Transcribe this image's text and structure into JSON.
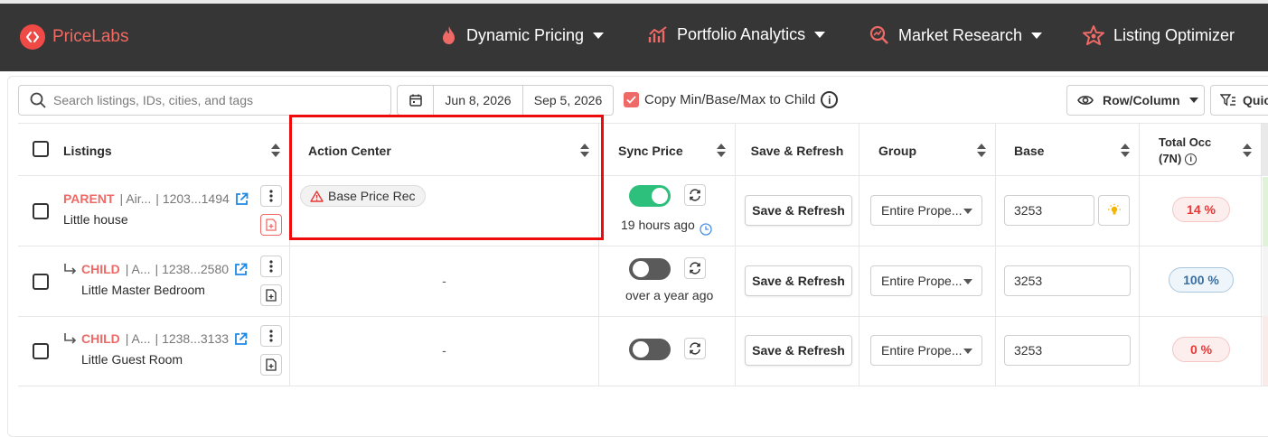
{
  "nav": {
    "brand": "PriceLabs",
    "items": [
      {
        "label": "Dynamic Pricing",
        "icon": "flame-icon"
      },
      {
        "label": "Portfolio Analytics",
        "icon": "chart-icon"
      },
      {
        "label": "Market Research",
        "icon": "magnifier-chart-icon"
      },
      {
        "label": "Listing Optimizer",
        "icon": "star-icon"
      }
    ]
  },
  "toolbar": {
    "search_placeholder": "Search listings, IDs, cities, and tags",
    "start_date": "Jun 8, 2026",
    "end_date": "Sep 5, 2026",
    "copy_label": "Copy Min/Base/Max to Child",
    "copy_checked": true,
    "rowcol_label": "Row/Column",
    "quick_label": "Quic"
  },
  "table": {
    "headers": {
      "listings": "Listings",
      "action_center": "Action Center",
      "sync_price": "Sync Price",
      "save_refresh": "Save & Refresh",
      "group": "Group",
      "base": "Base",
      "total_occ_1": "Total Occ",
      "total_occ_2": "(7N)"
    },
    "rows": [
      {
        "tag": "PARENT",
        "channel": "| Air...",
        "id": "| 1203...1494",
        "name": "Little house",
        "action": "Base Price Rec",
        "sync_on": true,
        "sync_time": "19 hours ago",
        "save_label": "Save & Refresh",
        "group": "Entire Prope...",
        "base": "3253",
        "occ": "14 %"
      },
      {
        "tag": "CHILD",
        "channel": "| A...",
        "id": "| 1238...2580",
        "name": "Little Master Bedroom",
        "action": "-",
        "sync_on": false,
        "sync_time": "over a year ago",
        "save_label": "Save & Refresh",
        "group": "Entire Prope...",
        "base": "3253",
        "occ": "100 %"
      },
      {
        "tag": "CHILD",
        "channel": "| A...",
        "id": "| 1238...3133",
        "name": "Little Guest Room",
        "action": "-",
        "sync_on": false,
        "sync_time": "",
        "save_label": "Save & Refresh",
        "group": "Entire Prope...",
        "base": "3253",
        "occ": "0 %"
      }
    ]
  },
  "colors": {
    "brand_red": "#f04a47",
    "nav_bg": "#363636",
    "toggle_on": "#2dbf7c",
    "toggle_off": "#5a5a5a",
    "highlight": "#ee0b0b"
  }
}
